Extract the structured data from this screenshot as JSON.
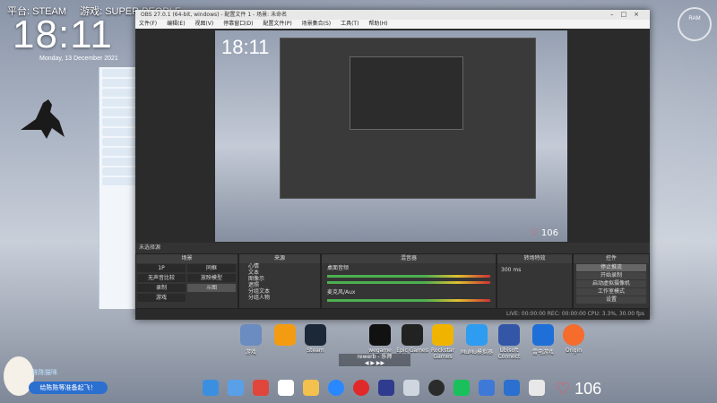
{
  "desktop": {
    "platform": "平台: STEAM",
    "game": "游戏: SUPER PEOPLE",
    "clock": "18:11",
    "date": "Monday, 13 December 2021",
    "ram_widget": "RAM"
  },
  "obs": {
    "title": "OBS 27.0.1 (64-bit, windows) - 配置文件 1 - 场景: 未命名",
    "menu": [
      "文件(F)",
      "编辑(E)",
      "视图(V)",
      "停靠窗口(D)",
      "配置文件(P)",
      "场景集合(S)",
      "工具(T)",
      "帮助(H)"
    ],
    "scene_label": "未选择源",
    "panels": {
      "scenes": "场景",
      "sources": "来源",
      "mixer": "混音器",
      "transitions": "转场特效",
      "controls": "控件"
    },
    "scenes": [
      "1P",
      "同框",
      "无声音比较",
      "放映模型",
      "录制",
      "斗图",
      "游戏",
      ""
    ],
    "sources": [
      "心情",
      "文本",
      "图像示",
      "遮照",
      "分组文本",
      "分组人物"
    ],
    "mixer": [
      "桌面音频",
      "麦克风/Aux"
    ],
    "transition_duration": "300 ms",
    "controls": [
      "停止推流",
      "开始录制",
      "启动虚拟摄像机",
      "工作室模式",
      "设置",
      "退出"
    ],
    "status": "LIVE: 00:00:00   REC: 00:00:00   CPU: 3.3%, 30.00 fps"
  },
  "preview": {
    "clock": "18:11",
    "heart_count": "106"
  },
  "desktop_icons": [
    "游戏",
    "",
    "Steam",
    "wegame",
    "Epic Games",
    "Rockstar Games",
    "MuMu模拟器",
    "Ubisoft Connect",
    "雷电游戏",
    "Origin"
  ],
  "player_text": "rewerb - 乐师",
  "heart_count": "106",
  "banner_text": "给陈陈等准备起飞！",
  "mascot_title": "陈陈猫咪",
  "colors": {
    "accent_red": "#ff4c5c",
    "obs_bg": "#2b2b2b"
  }
}
